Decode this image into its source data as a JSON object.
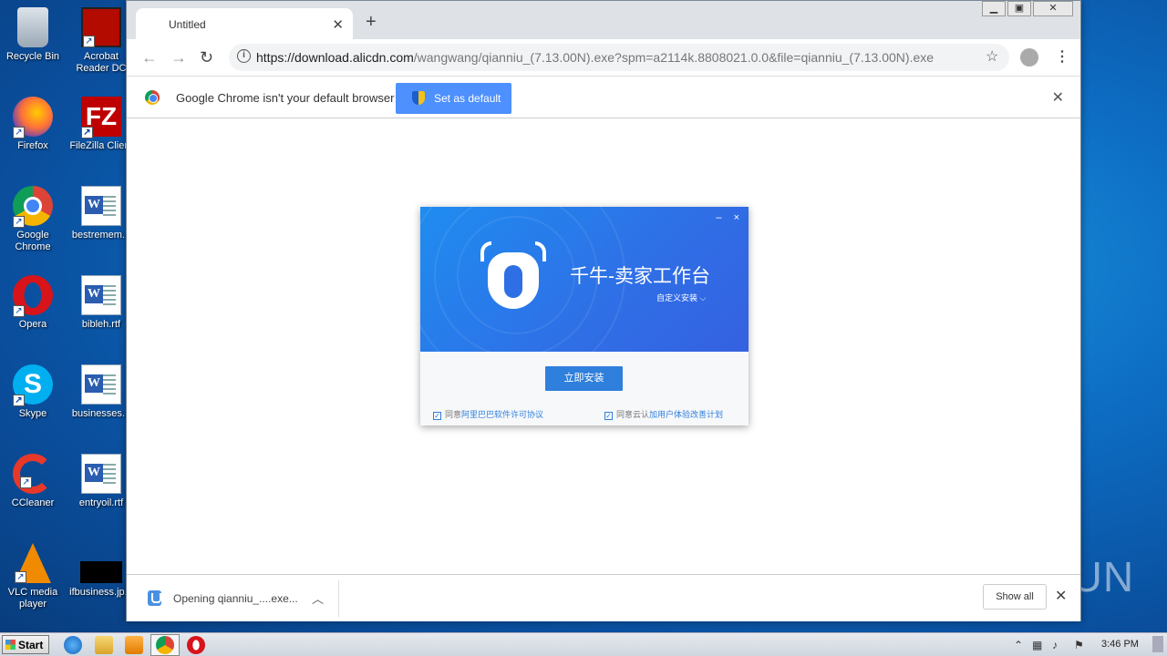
{
  "desktop": {
    "icons": [
      {
        "label": "Recycle Bin"
      },
      {
        "label": "Acrobat Reader DC"
      },
      {
        "label": "Firefox"
      },
      {
        "label": "FileZilla Client"
      },
      {
        "label": "Google Chrome"
      },
      {
        "label": "bestremem..."
      },
      {
        "label": "Opera"
      },
      {
        "label": "bibleh.rtf"
      },
      {
        "label": "Skype"
      },
      {
        "label": "businesses..."
      },
      {
        "label": "CCleaner"
      },
      {
        "label": "entryoil.rtf"
      },
      {
        "label": "VLC media player"
      },
      {
        "label": "ifbusiness.jp..."
      }
    ]
  },
  "browser": {
    "tab_title": "Untitled",
    "tab_close": "✕",
    "new_tab": "+",
    "url_host": "https://download.alicdn.com",
    "url_rest": "/wangwang/qianniu_(7.13.00N).exe?spm=a2114k.8808021.0.0&file=qianniu_(7.13.00N).exe",
    "infobar_text": "Google Chrome isn't your default browser",
    "set_default_label": "Set as default",
    "infobar_close": "✕"
  },
  "installer": {
    "title": "千牛-卖家工作台",
    "custom_install": "自定义安装 ⌵",
    "install_button": "立即安装",
    "agree_left_prefix": "同意",
    "agree_left_link": "阿里巴巴软件许可协议",
    "agree_right_prefix": "同意云认",
    "agree_right_link": "加用户体验改善计划",
    "minimize": "–",
    "close": "×"
  },
  "downloads": {
    "item_name": "Opening qianniu_....exe...",
    "show_all": "Show all",
    "close": "✕"
  },
  "watermark": "ANY.RUN",
  "taskbar": {
    "start_label": "Start",
    "clock": "3:46 PM"
  }
}
